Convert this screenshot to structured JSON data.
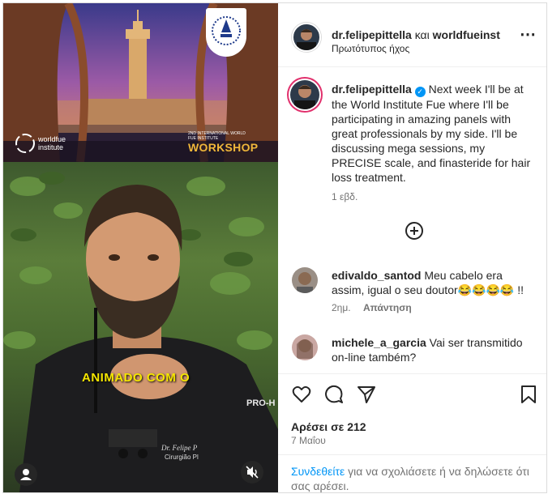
{
  "banner": {
    "brand_line1": "worldfue",
    "brand_line2": "institute",
    "workshop_sub": "2ND INTERNATIONAL WORLD FUE INSTITUTE",
    "workshop": "WORKSHOP"
  },
  "video": {
    "caption": "ANIMADO COM O",
    "name_tag": "Dr. Felipe P",
    "title_tag": "Cirurgião Pl",
    "brand_tag": "PRO-H"
  },
  "header": {
    "username": "dr.felipepittella",
    "connector": "και",
    "coauthor": "worldfueinst",
    "audio": "Πρωτότυπος ήχος",
    "more": "⋯"
  },
  "caption": {
    "username": "dr.felipepittella",
    "verified": "✓",
    "text": "Next week I'll be at the World Institute Fue where I'll be participating in amazing panels with great professionals by my side. I'll be discussing mega sessions, my PRECISE scale, and finasteride for hair loss treatment.",
    "time": "1 εβδ."
  },
  "comments": [
    {
      "username": "edivaldo_santod",
      "text": "Meu cabelo era assim, igual o seu doutor😂😂😂😂 !!",
      "time": "2ημ.",
      "reply": "Απάντηση"
    },
    {
      "username": "michele_a_garcia",
      "text": "Vai ser transmitido on-line também?"
    }
  ],
  "likes": "Αρέσει σε 212",
  "date": "7 Μαΐου",
  "login": {
    "link": "Συνδεθείτε",
    "rest": "για να σχολιάσετε ή να δηλώσετε ότι σας αρέσει."
  },
  "colors": {
    "verified": "#0095f6",
    "link": "#00376b",
    "caption_yellow": "#f5e600",
    "workshop_gold": "#f0b73a"
  }
}
